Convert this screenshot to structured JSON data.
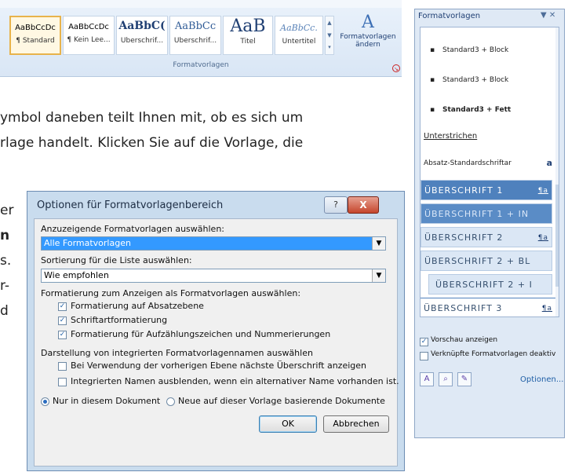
{
  "ribbon": {
    "tiles": [
      {
        "sample": "AaBbCcDc",
        "name": "¶ Standard"
      },
      {
        "sample": "AaBbCcDc",
        "name": "¶ Kein Lee..."
      },
      {
        "sample": "AaBbC(",
        "name": "Überschrif..."
      },
      {
        "sample": "AaBbCc",
        "name": "Überschrif..."
      },
      {
        "sample": "AaB",
        "name": "Titel"
      },
      {
        "sample": "AaBbCc.",
        "name": "Untertitel"
      }
    ],
    "change_styles_label": "Formatvorlagen ändern",
    "group_label": "Formatvorlagen"
  },
  "document": {
    "line1": "ymbol daneben teilt Ihnen mit, ob es sich um",
    "line2": "rlage handelt. Klicken Sie auf die Vorlage, die",
    "frag_er": "er",
    "frag_n": "n",
    "frag_s": "s.",
    "frag_r": "r-",
    "frag_d": "d"
  },
  "dialog": {
    "title": "Optionen für Formatvorlagenbereich",
    "help": "?",
    "close": "X",
    "show_label": "Anzuzeigende Formatvorlagen auswählen:",
    "show_value": "Alle Formatvorlagen",
    "sort_label": "Sortierung für die Liste auswählen:",
    "sort_value": "Wie empfohlen",
    "format_label": "Formatierung zum Anzeigen als Formatvorlagen auswählen:",
    "opt_para": "Formatierung auf Absatzebene",
    "opt_font": "Schriftartformatierung",
    "opt_list": "Formatierung für Aufzählungszeichen und Nummerierungen",
    "builtin_label": "Darstellung von integrierten Formatvorlagennamen auswählen",
    "opt_next_heading": "Bei Verwendung der vorherigen Ebene nächste Überschrift anzeigen",
    "opt_hide_builtin": "Integrierten Namen ausblenden, wenn ein alternativer Name vorhanden ist.",
    "radio_doc": "Nur in diesem Dokument",
    "radio_template": "Neue auf dieser Vorlage basierende Dokumente",
    "ok": "OK",
    "cancel": "Abbrechen"
  },
  "pane": {
    "title": "Formatvorlagen",
    "items": [
      {
        "label": "Standard3 + Block",
        "mark": ""
      },
      {
        "label": "Standard3 + Block",
        "mark": ""
      },
      {
        "label": "Standard3 + Fett",
        "mark": ""
      },
      {
        "label": "Unterstrichen",
        "mark": ""
      },
      {
        "label": "Absatz-Standardschriftar",
        "mark": "a"
      },
      {
        "label": "ÜBERSCHRIFT 1",
        "mark": "¶a"
      },
      {
        "label": "ÜBERSCHRIFT 1 + IN",
        "mark": ""
      },
      {
        "label": "ÜBERSCHRIFT 2",
        "mark": "¶a"
      },
      {
        "label": "ÜBERSCHRIFT 2 + BL",
        "mark": ""
      },
      {
        "label": "ÜBERSCHRIFT 2 + I",
        "mark": ""
      },
      {
        "label": "ÜBERSCHRIFT 3",
        "mark": "¶a"
      }
    ],
    "preview_label": "Vorschau anzeigen",
    "linked_label": "Verknüpfte Formatvorlagen deaktiv",
    "options_link": "Optionen..."
  }
}
